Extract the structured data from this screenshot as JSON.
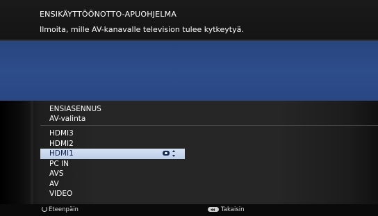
{
  "header": {
    "title": "ENSIKÄYTTÖÖNOTTO-APUOHJELMA",
    "description": "Ilmoita, mille AV-kanavalle television tulee kytkeytyä."
  },
  "section": {
    "heading": "ENSIASENNUS",
    "subheading": "AV-valinta"
  },
  "inputs": [
    {
      "label": "HDMI3",
      "selected": false
    },
    {
      "label": "HDMI2",
      "selected": false
    },
    {
      "label": "HDMI1",
      "selected": true
    },
    {
      "label": "PC IN",
      "selected": false
    },
    {
      "label": "AVS",
      "selected": false
    },
    {
      "label": "AV",
      "selected": false
    },
    {
      "label": "VIDEO",
      "selected": false
    }
  ],
  "footer": {
    "forward_label": "Eteenpäin",
    "back_label": "Takaisin"
  },
  "icons": {
    "ok": "ok-button-icon",
    "updown": "up-down-arrows-icon",
    "forward": "refresh-icon",
    "back": "rewind-button-icon"
  },
  "colors": {
    "blue_band": "#2d4c8a",
    "selection": "#c9d8ef",
    "selection_text": "#0b1e4a"
  }
}
